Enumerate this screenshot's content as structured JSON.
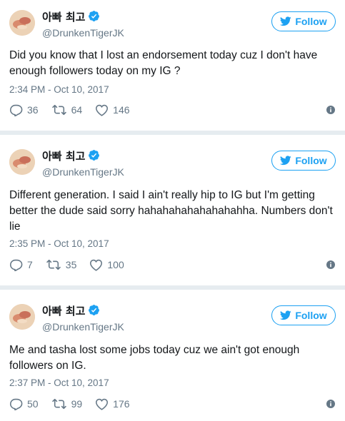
{
  "colors": {
    "accent": "#1da1f2",
    "secondary_text": "#657786",
    "primary_text": "#14171a",
    "background": "#e6ecf0"
  },
  "tweets": [
    {
      "display_name": "아빠 최고",
      "handle": "@DrunkenTigerJK",
      "follow_label": "Follow",
      "text": "Did you know that I lost an endorsement today cuz I don't have enough followers today on my IG ?",
      "timestamp": "2:34 PM - Oct 10, 2017",
      "replies": "36",
      "retweets": "64",
      "likes": "146",
      "icons": [
        "avatar",
        "verified-badge-icon",
        "twitter-bird-icon",
        "reply-icon",
        "retweet-icon",
        "like-heart-icon",
        "info-icon"
      ]
    },
    {
      "display_name": "아빠 최고",
      "handle": "@DrunkenTigerJK",
      "follow_label": "Follow",
      "text": "Different generation. I said I ain't really hip to IG but I'm getting better the dude said sorry hahahahahahahahahha. Numbers don't lie",
      "timestamp": "2:35 PM - Oct 10, 2017",
      "replies": "7",
      "retweets": "35",
      "likes": "100",
      "icons": [
        "avatar",
        "verified-badge-icon",
        "twitter-bird-icon",
        "reply-icon",
        "retweet-icon",
        "like-heart-icon",
        "info-icon"
      ]
    },
    {
      "display_name": "아빠 최고",
      "handle": "@DrunkenTigerJK",
      "follow_label": "Follow",
      "text": "Me and tasha lost some jobs today cuz we ain't got enough followers on IG.",
      "timestamp": "2:37 PM - Oct 10, 2017",
      "replies": "50",
      "retweets": "99",
      "likes": "176",
      "icons": [
        "avatar",
        "verified-badge-icon",
        "twitter-bird-icon",
        "reply-icon",
        "retweet-icon",
        "like-heart-icon",
        "info-icon"
      ]
    }
  ]
}
